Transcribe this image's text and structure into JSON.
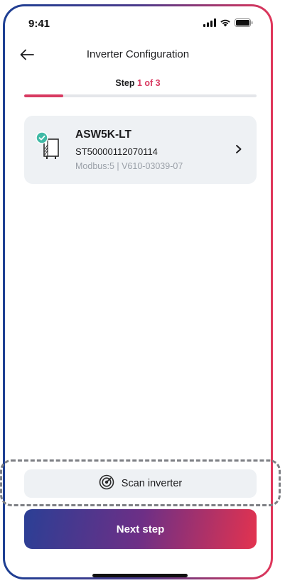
{
  "status_bar": {
    "time": "9:41",
    "icons": [
      "cellular-signal-icon",
      "wifi-icon",
      "battery-icon"
    ]
  },
  "header": {
    "back_icon": "arrow-left-icon",
    "title": "Inverter Configuration"
  },
  "stepper": {
    "prefix": "Step",
    "current": "1 of 3",
    "progress_fraction": 0.1667,
    "accent_color": "#d83a61",
    "track_color": "#e4e6ea"
  },
  "inverter_card": {
    "icon": "inverter-connected-icon",
    "model": "ASW5K-LT",
    "serial": "ST50000112070114",
    "meta": "Modbus:5 | V610-03039-07",
    "chevron_icon": "chevron-right-icon"
  },
  "scan_button": {
    "icon": "radar-scan-icon",
    "label": "Scan inverter"
  },
  "next_button": {
    "label": "Next step",
    "gradient": [
      "#2b3f95",
      "#6d2f86",
      "#e3334f"
    ]
  }
}
